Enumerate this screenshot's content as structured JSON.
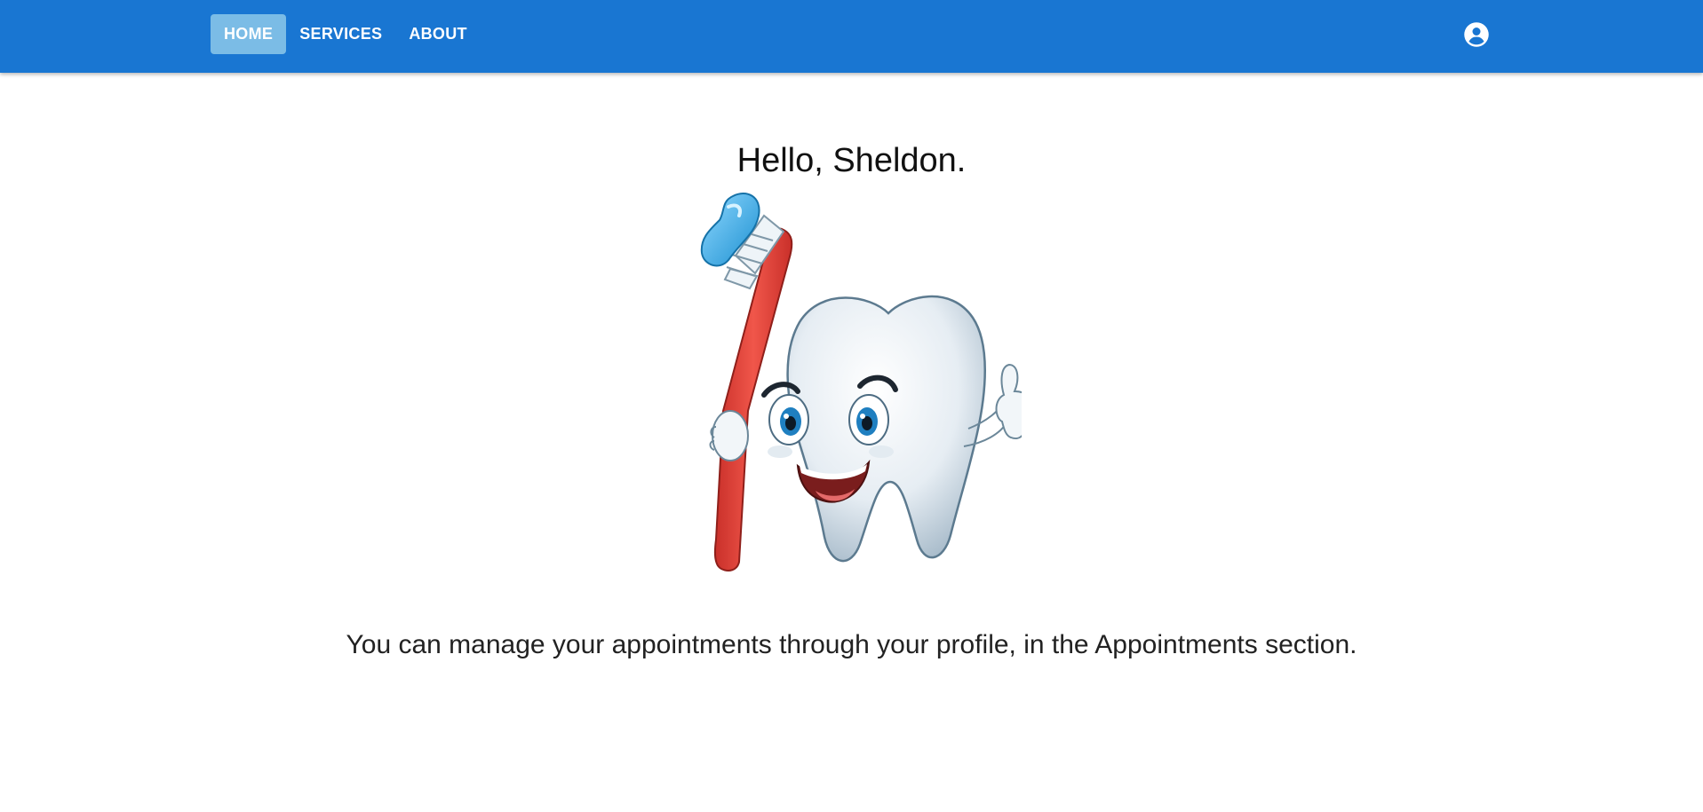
{
  "header": {
    "nav": [
      {
        "label": "HOME",
        "active": true
      },
      {
        "label": "SERVICES",
        "active": false
      },
      {
        "label": "ABOUT",
        "active": false
      }
    ],
    "account_icon": "account-circle-icon"
  },
  "main": {
    "greeting": "Hello, Sheldon.",
    "illustration": "tooth-with-toothbrush-illustration",
    "message": "You can manage your appointments through your profile, in the Appointments section."
  },
  "colors": {
    "appbar": "#1976d2",
    "active_nav": "#7bbce6",
    "toothbrush": "#e8483b",
    "toothpaste": "#3fa9e0"
  }
}
